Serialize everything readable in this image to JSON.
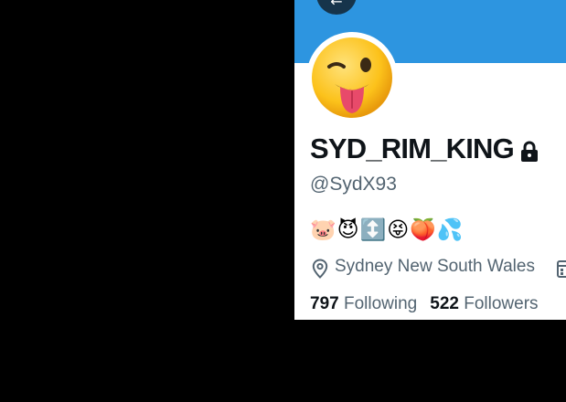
{
  "profile": {
    "display_name": "SYD_RIM_KING",
    "handle": "@SydX93",
    "bio": "🐷😈↕️😝🍑💦",
    "location": "Sydney New South Wales",
    "following_count": "797",
    "following_label": "Following",
    "followers_count": "522",
    "followers_label": "Followers"
  },
  "icons": {
    "back": "arrow-left-icon",
    "avatar": "winking-tongue-emoji",
    "protected": "lock-icon",
    "location": "location-pin-icon",
    "joined": "calendar-icon"
  },
  "colors": {
    "banner": "#2d95e0",
    "text_primary": "#0f1419",
    "text_secondary": "#536471",
    "background": "#000000"
  }
}
